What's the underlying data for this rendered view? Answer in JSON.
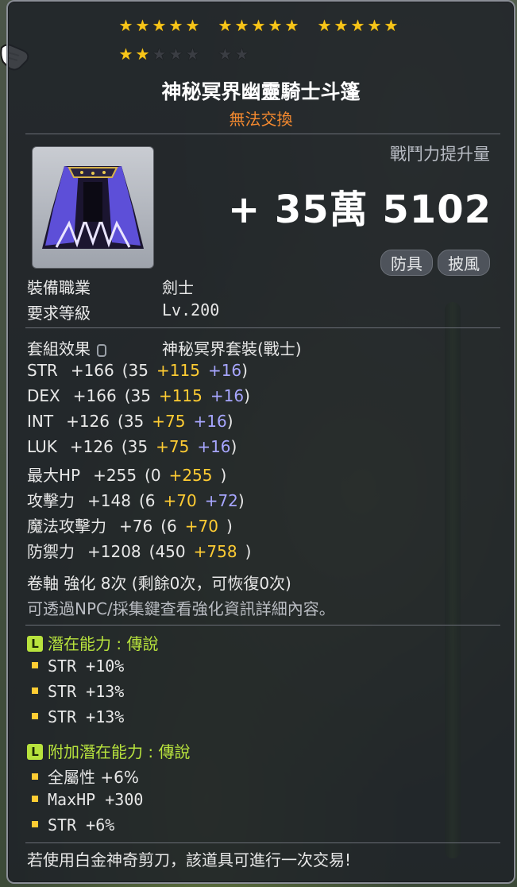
{
  "stars": {
    "total": 22,
    "filled": 17,
    "group_size": 5
  },
  "item": {
    "name": "神秘冥界幽靈騎士斗篷",
    "trade_status": "無法交換",
    "power_label": "戰鬥力提升量",
    "power_value": "+ 35萬 5102",
    "tags": [
      "防具",
      "披風"
    ]
  },
  "requirements": [
    {
      "label": "裝備職業",
      "value": "劍士"
    },
    {
      "label": "要求等級",
      "value": "Lv.200"
    }
  ],
  "set_effect": {
    "label": "套組效果",
    "value": "神秘冥界套裝(戰士)"
  },
  "stats": [
    {
      "name": "STR",
      "total": "+166",
      "open": "(35",
      "add1": "+115",
      "add2": "+16",
      "close": ")"
    },
    {
      "name": "DEX",
      "total": "+166",
      "open": "(35",
      "add1": "+115",
      "add2": "+16",
      "close": ")"
    },
    {
      "name": "INT",
      "total": "+126",
      "open": "(35",
      "add1": "+75",
      "add2": "+16",
      "close": ")"
    },
    {
      "name": "LUK",
      "total": "+126",
      "open": "(35",
      "add1": "+75",
      "add2": "+16",
      "close": ")"
    },
    {
      "name": "最大HP",
      "total": "+255",
      "open": "(0",
      "add1": "+255",
      "add2": "",
      "close": ")"
    },
    {
      "name": "攻擊力",
      "total": "+148",
      "open": "(6",
      "add1": "+70",
      "add2": "+72",
      "close": ")"
    },
    {
      "name": "魔法攻擊力",
      "total": "+76",
      "open": "(6",
      "add1": "+70",
      "add2": "",
      "close": ")"
    },
    {
      "name": "防禦力",
      "total": "+1208",
      "open": "(450",
      "add1": "+758",
      "add2": "",
      "close": ")"
    }
  ],
  "scroll_line": "卷軸 強化 8次 (剩餘0次，可恢復0次)",
  "scroll_hint": "可透過NPC/採集鍵查看強化資訊詳細內容。",
  "potential": {
    "badge": "L",
    "title": "潛在能力 : 傳說",
    "lines": [
      "STR +10%",
      "STR +13%",
      "STR +13%"
    ]
  },
  "bonus_potential": {
    "badge": "L",
    "title": "附加潛在能力 : 傳說",
    "lines": [
      "全屬性 +6%",
      "MaxHP +300",
      "STR +6%"
    ]
  },
  "footer": "若使用白金神奇剪刀，該道具可進行一次交易!",
  "colors": {
    "trade": "#f58a2f",
    "star_on": "#f7c519",
    "yellow_bonus": "#ffcc33",
    "blue_bonus": "#a7a6ff",
    "legend_green": "#b8e33d"
  }
}
